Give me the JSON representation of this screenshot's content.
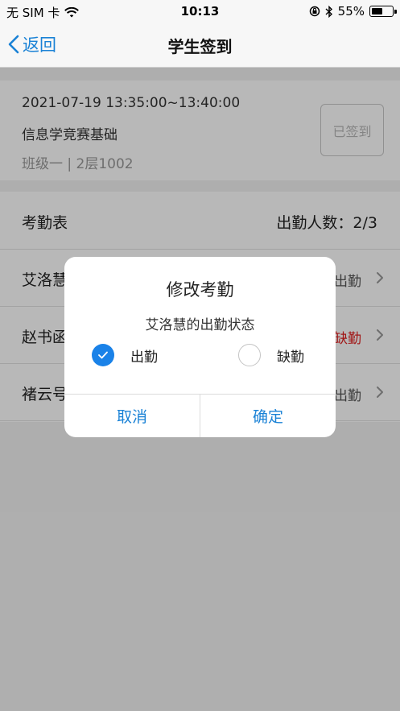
{
  "status_bar": {
    "carrier": "无 SIM 卡",
    "time": "10:13",
    "battery_percent": "55%",
    "battery_level": 0.55
  },
  "nav": {
    "back_label": "返回",
    "title": "学生签到"
  },
  "session": {
    "time_range": "2021-07-19 13:35:00~13:40:00",
    "course": "信息学竞赛基础",
    "location": "班级一 | 2层1002",
    "signed_label": "已签到"
  },
  "attendance": {
    "title": "考勤表",
    "count_label": "出勤人数：2/3",
    "rows": [
      {
        "name": "艾洛慧",
        "status": "出勤",
        "absent": false
      },
      {
        "name": "赵书函",
        "status": "缺勤",
        "absent": true
      },
      {
        "name": "褚云号",
        "status": "出勤",
        "absent": false
      }
    ]
  },
  "dialog": {
    "title": "修改考勤",
    "subtitle": "艾洛慧的出勤状态",
    "option_present": "出勤",
    "option_absent": "缺勤",
    "cancel_label": "取消",
    "confirm_label": "确定"
  },
  "colors": {
    "accent": "#1a82e8",
    "absent": "#e02020"
  },
  "icons": [
    "no-sim",
    "wifi-icon",
    "rotation-lock-icon",
    "bluetooth-icon",
    "battery-icon",
    "chevron-left-icon",
    "chevron-right-icon",
    "check-icon"
  ]
}
